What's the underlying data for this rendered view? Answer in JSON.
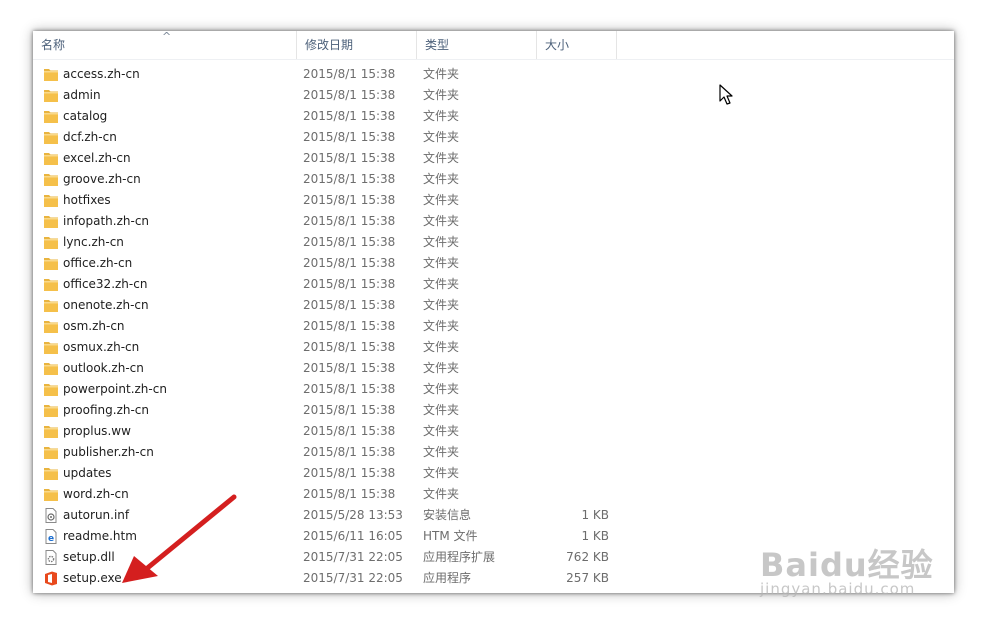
{
  "columns": {
    "name": "名称",
    "date": "修改日期",
    "type": "类型",
    "size": "大小"
  },
  "files": [
    {
      "name": "access.zh-cn",
      "date": "2015/8/1 15:38",
      "type": "文件夹",
      "size": "",
      "icon": "folder-icon"
    },
    {
      "name": "admin",
      "date": "2015/8/1 15:38",
      "type": "文件夹",
      "size": "",
      "icon": "folder-icon"
    },
    {
      "name": "catalog",
      "date": "2015/8/1 15:38",
      "type": "文件夹",
      "size": "",
      "icon": "folder-icon"
    },
    {
      "name": "dcf.zh-cn",
      "date": "2015/8/1 15:38",
      "type": "文件夹",
      "size": "",
      "icon": "folder-icon"
    },
    {
      "name": "excel.zh-cn",
      "date": "2015/8/1 15:38",
      "type": "文件夹",
      "size": "",
      "icon": "folder-icon"
    },
    {
      "name": "groove.zh-cn",
      "date": "2015/8/1 15:38",
      "type": "文件夹",
      "size": "",
      "icon": "folder-icon"
    },
    {
      "name": "hotfixes",
      "date": "2015/8/1 15:38",
      "type": "文件夹",
      "size": "",
      "icon": "folder-icon"
    },
    {
      "name": "infopath.zh-cn",
      "date": "2015/8/1 15:38",
      "type": "文件夹",
      "size": "",
      "icon": "folder-icon"
    },
    {
      "name": "lync.zh-cn",
      "date": "2015/8/1 15:38",
      "type": "文件夹",
      "size": "",
      "icon": "folder-icon"
    },
    {
      "name": "office.zh-cn",
      "date": "2015/8/1 15:38",
      "type": "文件夹",
      "size": "",
      "icon": "folder-icon"
    },
    {
      "name": "office32.zh-cn",
      "date": "2015/8/1 15:38",
      "type": "文件夹",
      "size": "",
      "icon": "folder-icon"
    },
    {
      "name": "onenote.zh-cn",
      "date": "2015/8/1 15:38",
      "type": "文件夹",
      "size": "",
      "icon": "folder-icon"
    },
    {
      "name": "osm.zh-cn",
      "date": "2015/8/1 15:38",
      "type": "文件夹",
      "size": "",
      "icon": "folder-icon"
    },
    {
      "name": "osmux.zh-cn",
      "date": "2015/8/1 15:38",
      "type": "文件夹",
      "size": "",
      "icon": "folder-icon"
    },
    {
      "name": "outlook.zh-cn",
      "date": "2015/8/1 15:38",
      "type": "文件夹",
      "size": "",
      "icon": "folder-icon"
    },
    {
      "name": "powerpoint.zh-cn",
      "date": "2015/8/1 15:38",
      "type": "文件夹",
      "size": "",
      "icon": "folder-icon"
    },
    {
      "name": "proofing.zh-cn",
      "date": "2015/8/1 15:38",
      "type": "文件夹",
      "size": "",
      "icon": "folder-icon"
    },
    {
      "name": "proplus.ww",
      "date": "2015/8/1 15:38",
      "type": "文件夹",
      "size": "",
      "icon": "folder-icon"
    },
    {
      "name": "publisher.zh-cn",
      "date": "2015/8/1 15:38",
      "type": "文件夹",
      "size": "",
      "icon": "folder-icon"
    },
    {
      "name": "updates",
      "date": "2015/8/1 15:38",
      "type": "文件夹",
      "size": "",
      "icon": "folder-icon"
    },
    {
      "name": "word.zh-cn",
      "date": "2015/8/1 15:38",
      "type": "文件夹",
      "size": "",
      "icon": "folder-icon"
    },
    {
      "name": "autorun.inf",
      "date": "2015/5/28 13:53",
      "type": "安装信息",
      "size": "1 KB",
      "icon": "inf-file-icon"
    },
    {
      "name": "readme.htm",
      "date": "2015/6/11 16:05",
      "type": "HTM 文件",
      "size": "1 KB",
      "icon": "html-file-icon"
    },
    {
      "name": "setup.dll",
      "date": "2015/7/31 22:05",
      "type": "应用程序扩展",
      "size": "762 KB",
      "icon": "dll-file-icon"
    },
    {
      "name": "setup.exe",
      "date": "2015/7/31 22:05",
      "type": "应用程序",
      "size": "257 KB",
      "icon": "office-setup-icon"
    }
  ],
  "watermark": {
    "logo": "Baidu经验",
    "site": "jingyan.baidu.com"
  },
  "colors": {
    "folder": "#f5c04a",
    "annotation_arrow": "#d41f1f",
    "header_text": "#4c607a"
  }
}
